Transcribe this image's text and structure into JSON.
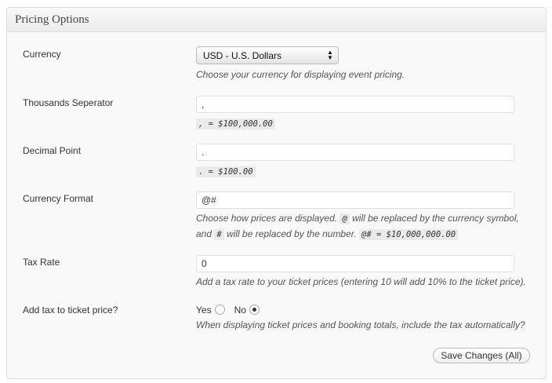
{
  "panel": {
    "title": "Pricing Options"
  },
  "currency": {
    "label": "Currency",
    "selected": "USD - U.S. Dollars",
    "desc": "Choose your currency for displaying event pricing."
  },
  "thousands": {
    "label": "Thousands Seperator",
    "value": ",",
    "example": ", = $100,000.00"
  },
  "decimal": {
    "label": "Decimal Point",
    "value": ".",
    "example": ". = $100.00"
  },
  "format": {
    "label": "Currency Format",
    "value": "@#",
    "desc1_a": "Choose how prices are displayed. ",
    "code_at": "@",
    "desc1_b": " will be replaced by the currency symbol,",
    "desc2_a": "and ",
    "code_hash": "#",
    "desc2_b": " will be replaced by the number. ",
    "code_example": "@# = $10,000,000.00"
  },
  "tax": {
    "label": "Tax Rate",
    "value": "0",
    "desc": "Add a tax rate to your ticket prices (entering 10 will add 10% to the ticket price)."
  },
  "add_tax": {
    "label": "Add tax to ticket price?",
    "yes_label": "Yes",
    "no_label": "No",
    "selected": "No",
    "desc": "When displaying ticket prices and booking totals, include the tax automatically?"
  },
  "save_button": "Save Changes (All)"
}
